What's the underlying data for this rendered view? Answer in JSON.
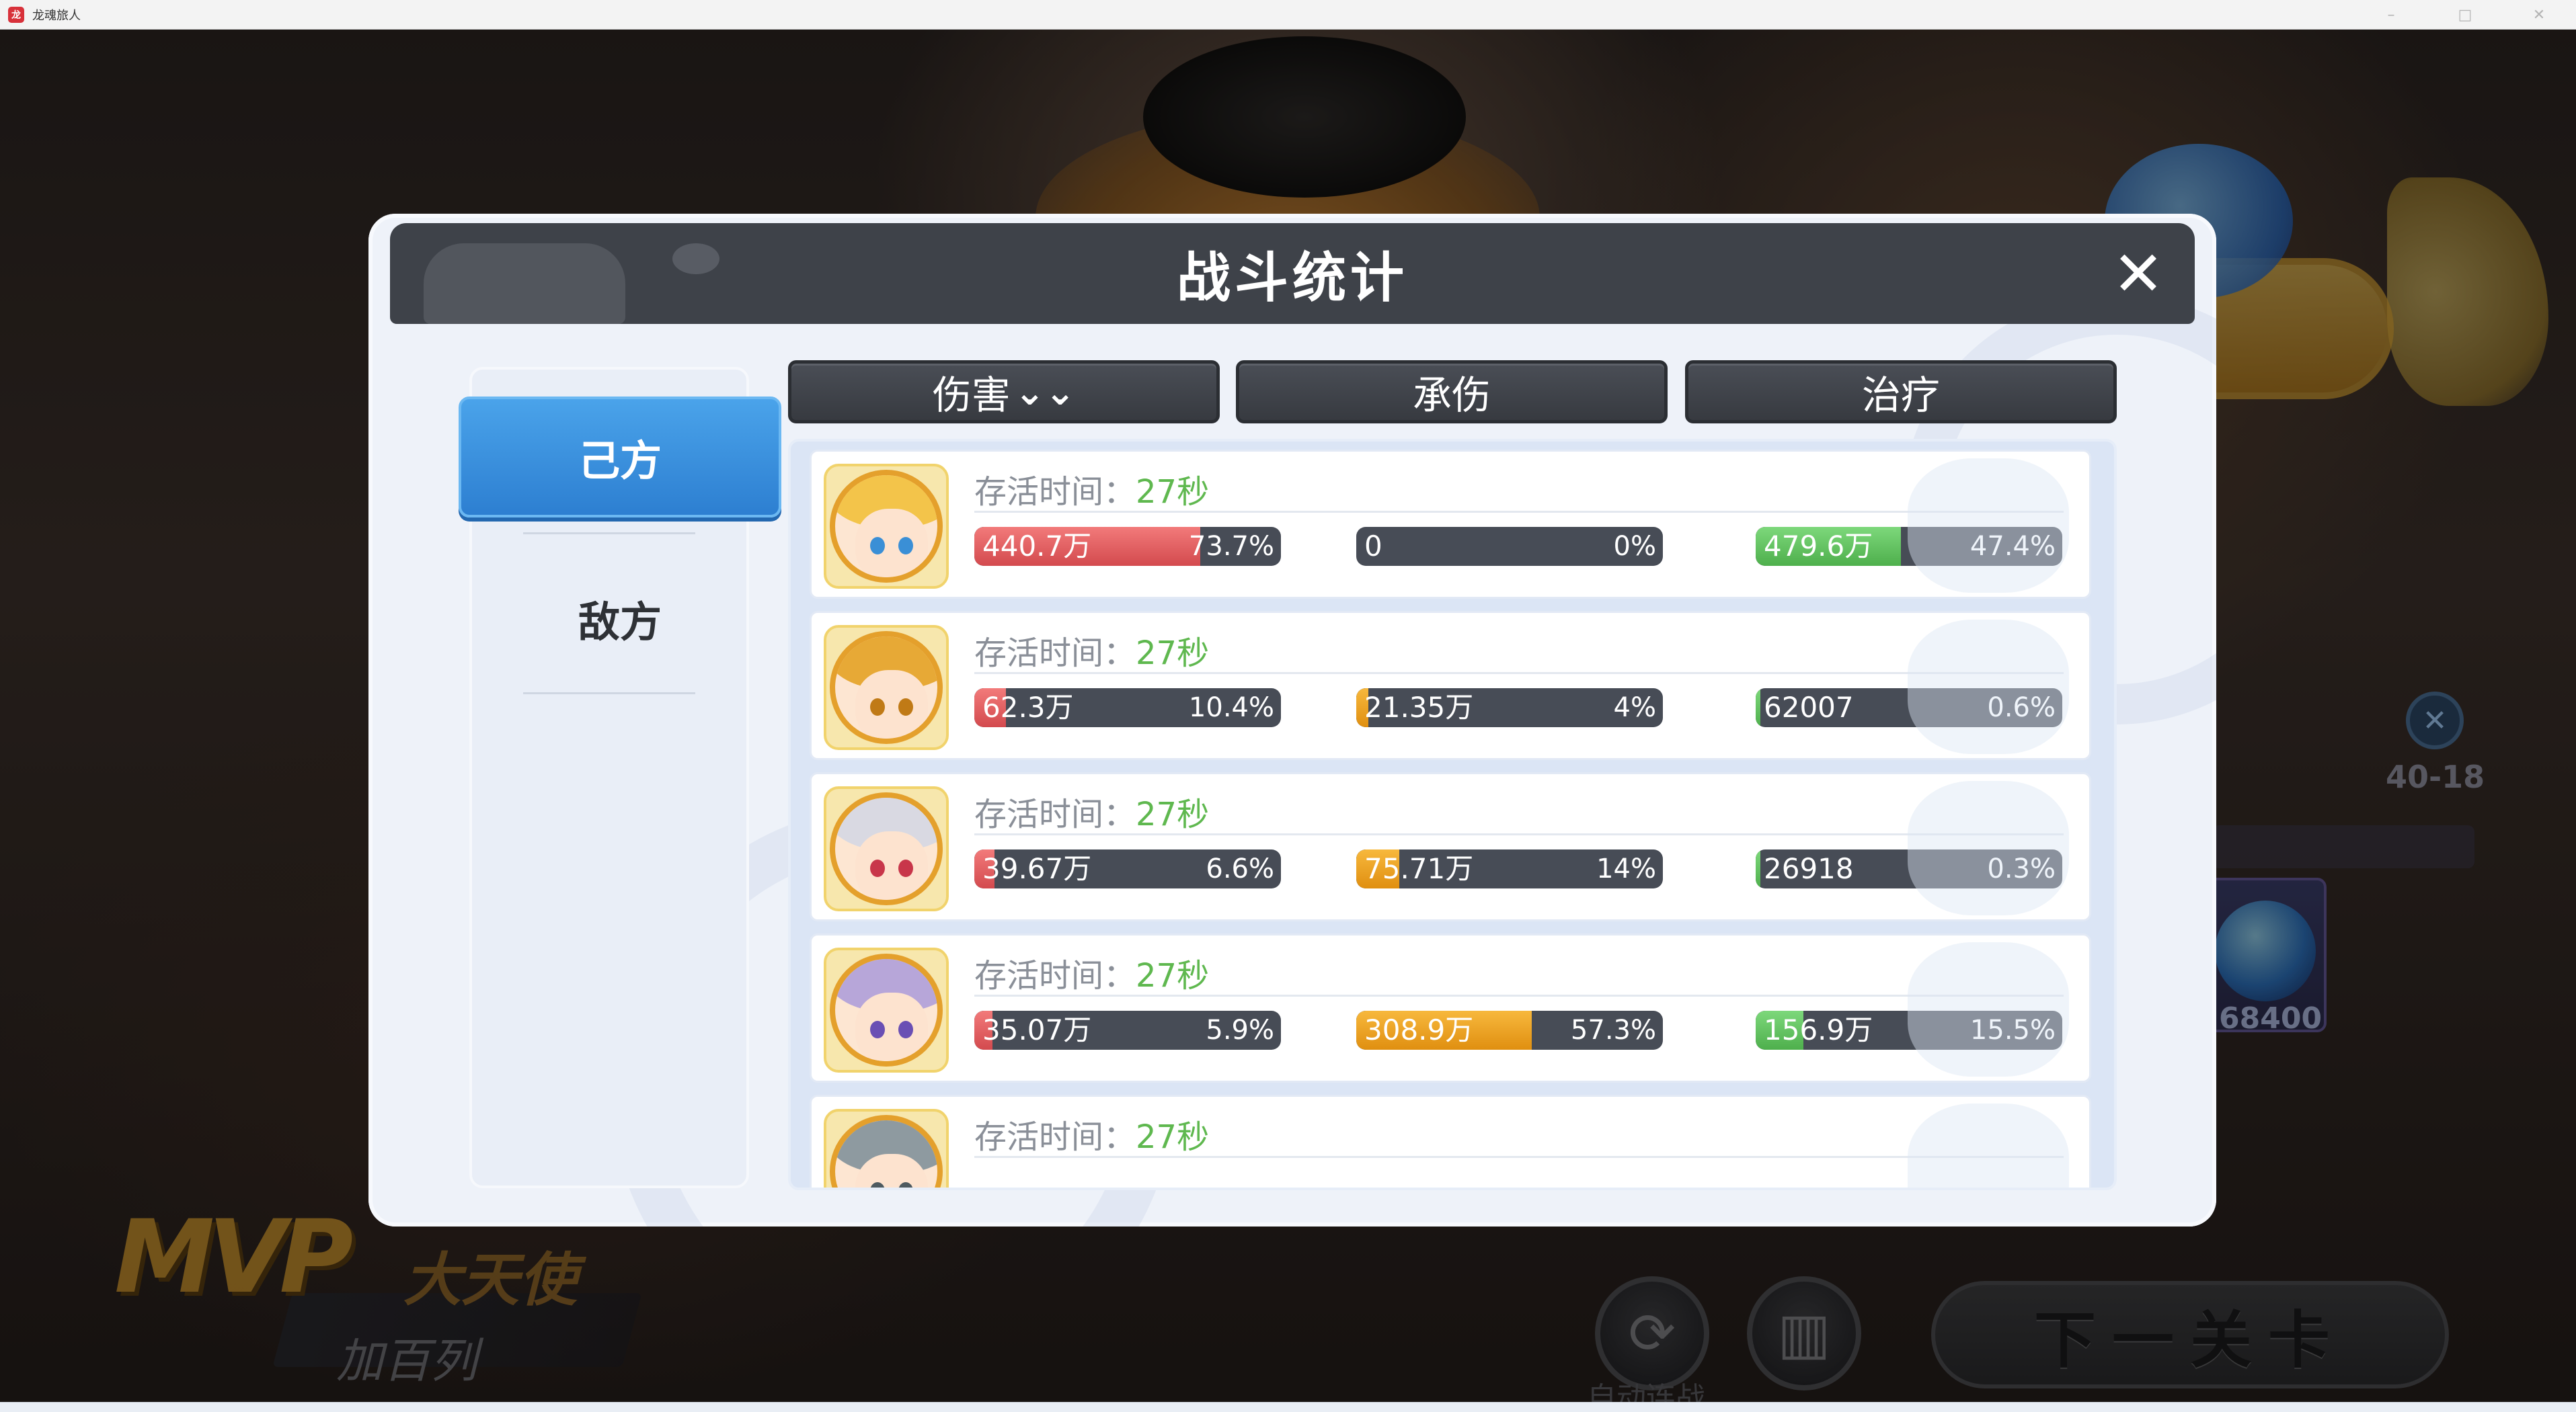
{
  "window": {
    "title": "龙魂旅人"
  },
  "scene": {
    "stage_label": "40-18",
    "orb_value": "68400",
    "mvp_badge": "MVP",
    "mvp_title": "大天使",
    "mvp_name": "加百列",
    "auto_label": "自动连战",
    "next_button": "下一关卡"
  },
  "modal": {
    "title": "战斗统计",
    "close_symbol": "✕",
    "sides": {
      "ally": "己方",
      "enemy": "敌方"
    },
    "tabs": [
      {
        "label": "伤害",
        "suffix": "⌄⌄"
      },
      {
        "label": "承伤",
        "suffix": ""
      },
      {
        "label": "治疗",
        "suffix": ""
      }
    ],
    "survival_label": "存活时间：",
    "rows": [
      {
        "survival": "27秒",
        "avatar": {
          "hair": "#f3c44a",
          "eyes": "#3a8fd6",
          "icon": "blonde-hero-avatar"
        },
        "damage": {
          "amount": "440.7万",
          "percent": "73.7%",
          "fill": 0.737
        },
        "taken": {
          "amount": "0",
          "percent": "0%",
          "fill": 0
        },
        "heal": {
          "amount": "479.6万",
          "percent": "47.4%",
          "fill": 0.474
        }
      },
      {
        "survival": "27秒",
        "avatar": {
          "hair": "#e7a936",
          "eyes": "#c07a16",
          "icon": "golden-hair-avatar"
        },
        "damage": {
          "amount": "62.3万",
          "percent": "10.4%",
          "fill": 0.104
        },
        "taken": {
          "amount": "21.35万",
          "percent": "4%",
          "fill": 0.04
        },
        "heal": {
          "amount": "62007",
          "percent": "0.6%",
          "fill": 0.006
        }
      },
      {
        "survival": "27秒",
        "avatar": {
          "hair": "#d9d9e2",
          "eyes": "#c8364a",
          "icon": "silver-hair-avatar"
        },
        "damage": {
          "amount": "39.67万",
          "percent": "6.6%",
          "fill": 0.066
        },
        "taken": {
          "amount": "75.71万",
          "percent": "14%",
          "fill": 0.14
        },
        "heal": {
          "amount": "26918",
          "percent": "0.3%",
          "fill": 0.003
        }
      },
      {
        "survival": "27秒",
        "avatar": {
          "hair": "#b7a6d9",
          "eyes": "#6a4fb4",
          "icon": "knight-helmet-avatar"
        },
        "damage": {
          "amount": "35.07万",
          "percent": "5.9%",
          "fill": 0.059
        },
        "taken": {
          "amount": "308.9万",
          "percent": "57.3%",
          "fill": 0.573
        },
        "heal": {
          "amount": "156.9万",
          "percent": "15.5%",
          "fill": 0.155
        }
      },
      {
        "survival": "27秒",
        "avatar": {
          "hair": "#8e9aa0",
          "eyes": "#4e5a60",
          "icon": "robot-avatar"
        }
      }
    ]
  },
  "colors": {
    "damage_fill": "#d34a4e",
    "taken_fill": "#e08f10",
    "heal_fill": "#4eaf4c",
    "survival_value": "#5fb84f",
    "active_side_tab": "#2d7fd1"
  }
}
